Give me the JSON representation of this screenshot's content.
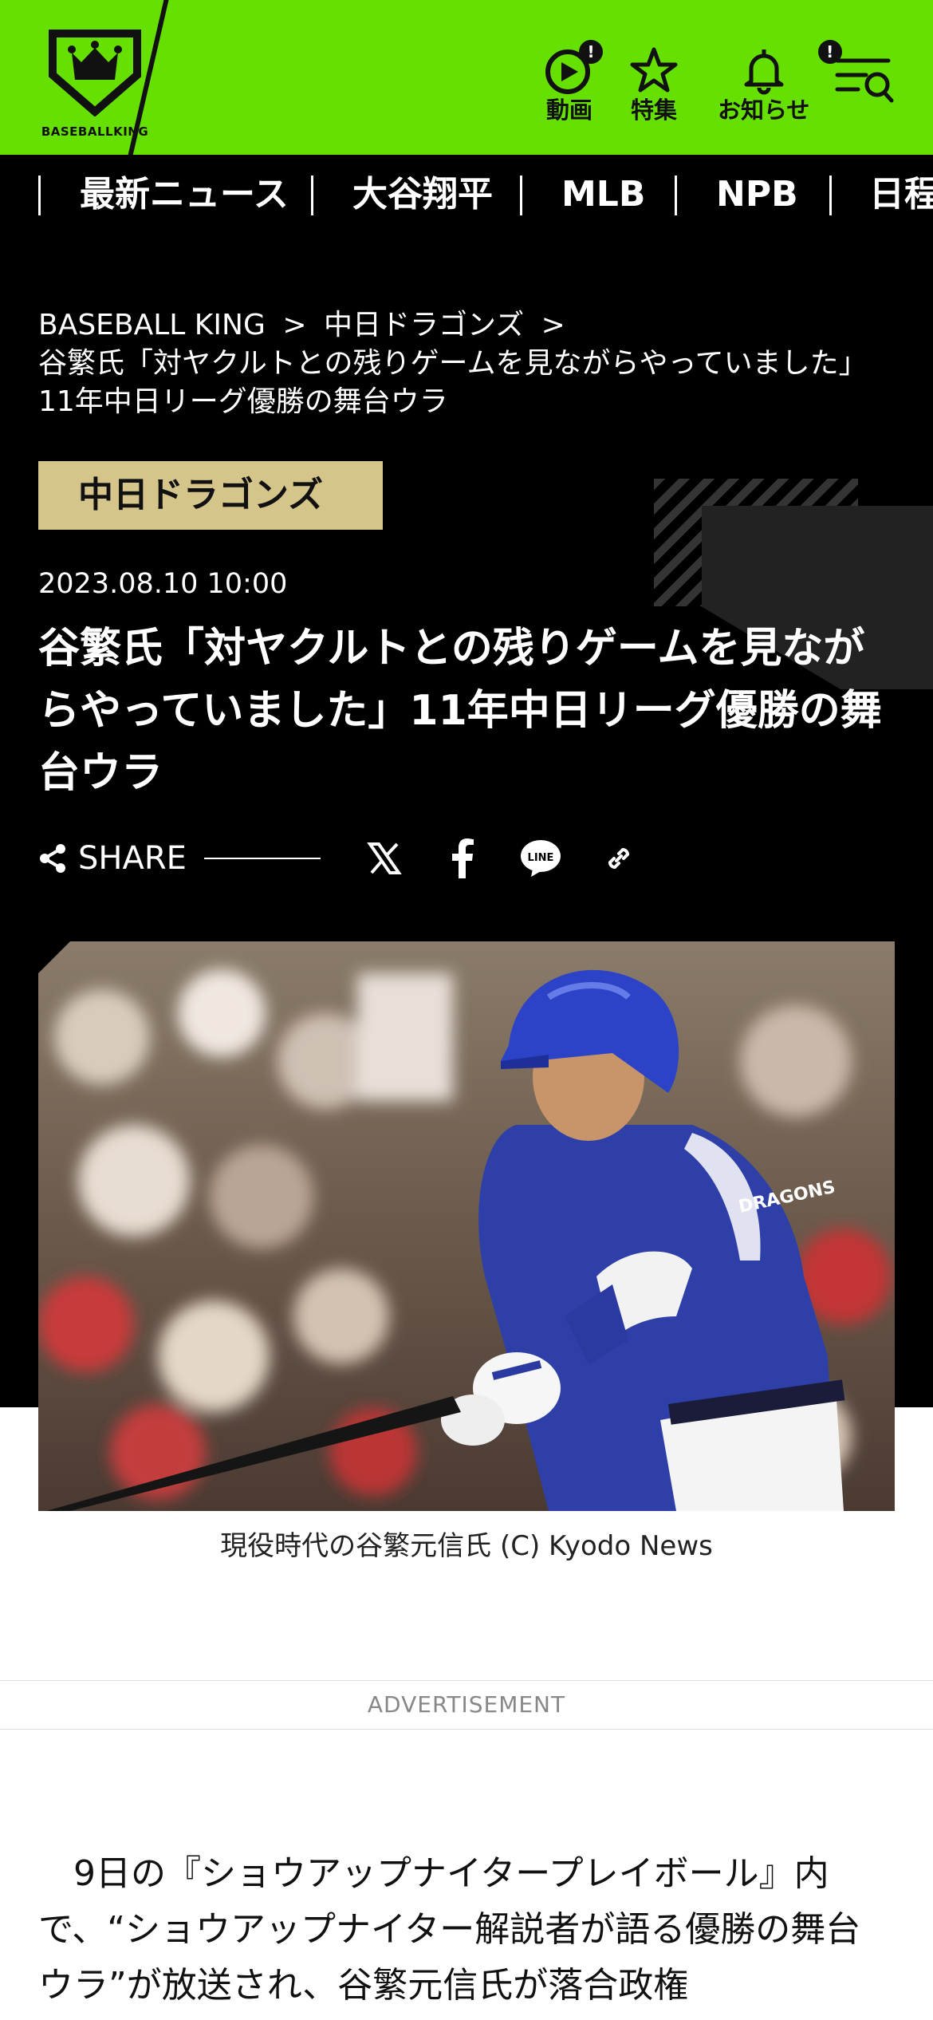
{
  "header": {
    "logo_text": "BASEBALLKING",
    "nav": [
      {
        "label": "動画",
        "icon": "play-icon",
        "badge": "!"
      },
      {
        "label": "特集",
        "icon": "star-icon"
      },
      {
        "label": "お知らせ",
        "icon": "bell-icon",
        "badge": "!"
      }
    ],
    "menu_icon": "menu-search-icon",
    "accent_color": "#66e000"
  },
  "category_nav": [
    "最新ニュース",
    "大谷翔平",
    "MLB",
    "NPB",
    "日程"
  ],
  "breadcrumb": {
    "home": "BASEBALL KING",
    "category": "中日ドラゴンズ",
    "current": "谷繁氏「対ヤクルトとの残りゲームを見ながらやっていました」11年中日リーグ優勝の舞台ウラ",
    "separator": ">"
  },
  "article": {
    "category": "中日ドラゴンズ",
    "date": "2023.08.10 10:00",
    "title": "谷繁氏「対ヤクルトとの残りゲームを見ながらやっていました」11年中日リーグ優勝の舞台ウラ",
    "share_label": "SHARE",
    "share_buttons": [
      "x-icon",
      "facebook-icon",
      "line-icon",
      "link-icon"
    ],
    "line_text": "LINE",
    "photo_caption": "現役時代の谷繁元信氏 (C) Kyodo News",
    "badge_color": "#d6c58a",
    "body": "9日の『ショウアップナイタープレイボール』内で、“ショウアップナイター解説者が語る優勝の舞台ウラ”が放送され、谷繁元信氏が落合政権"
  },
  "ad_label": "ADVERTISEMENT"
}
